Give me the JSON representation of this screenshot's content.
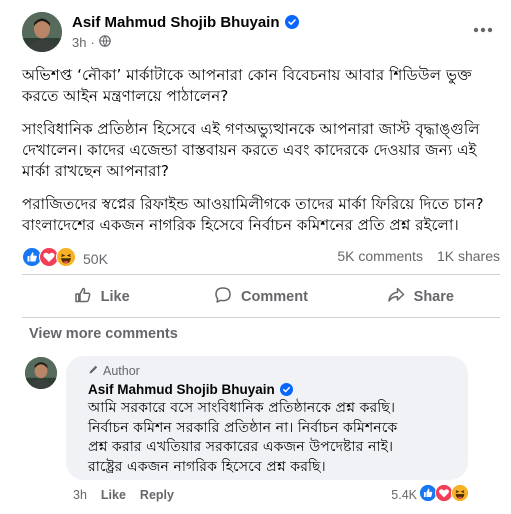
{
  "post": {
    "author": "Asif Mahmud Shojib Bhuyain",
    "time": "3h",
    "paragraphs": [
      "অভিশপ্ত ‘নৌকা’ মার্কাটাকে আপনারা কোন বিবেচনায় আবার শিডিউল ভুক্ত করতে আইন মন্ত্রণালয়ে পাঠালেন?",
      "সাংবিধানিক প্রতিষ্ঠান হিসেবে এই গণঅভ্যুত্থানকে আপনারা জাস্ট বৃদ্ধাঙ্গুলি দেখালেন। কাদের এজেন্ডা বাস্তবায়ন করতে এবং কাদেরকে দেওয়ার জন্য এই মার্কা রাখছেন আপনারা?",
      "পরাজিতদের স্বপ্নের রিফাইন্ড আওয়ামিলীগকে তাদের মার্কা ফিরিয়ে দিতে চান? বাংলাদেশের একজন নাগরিক হিসেবে নির্বাচন কমিশনের প্রতি প্রশ্ন রইলো।"
    ]
  },
  "stats": {
    "reactions_count": "50K",
    "comments": "5K comments",
    "shares": "1K shares"
  },
  "actions": {
    "like": "Like",
    "comment": "Comment",
    "share": "Share"
  },
  "view_more": "View more comments",
  "comment": {
    "badge": "Author",
    "author": "Asif Mahmud Shojib Bhuyain",
    "lines": [
      "আমি সরকারে বসে সাংবিধানিক প্রতিষ্ঠানকে প্রশ্ন করছি।",
      "নির্বাচন কমিশন সরকারি প্রতিষ্ঠান না। নির্বাচন কমিশনকে",
      "প্রশ্ন করার এখতিয়ার সরকারের একজন উপদেষ্টার নাই।",
      "রাষ্ট্রের একজন নাগরিক হিসেবে প্রশ্ন করছি।"
    ],
    "time": "3h",
    "like": "Like",
    "reply": "Reply",
    "reactions_count": "5.4K"
  },
  "colors": {
    "like_blue": "#1877f2",
    "love_red": "#f33e58",
    "haha_yellow": "#f7b125",
    "verified_blue": "#0866ff",
    "muted_text": "#65676b",
    "bubble_bg": "#f0f2f5"
  },
  "icons": [
    "verified-badge-icon",
    "globe-icon",
    "more-icon",
    "like-reaction-icon",
    "love-reaction-icon",
    "haha-reaction-icon",
    "thumbs-up-icon",
    "comment-icon",
    "share-icon",
    "author-pen-icon"
  ]
}
